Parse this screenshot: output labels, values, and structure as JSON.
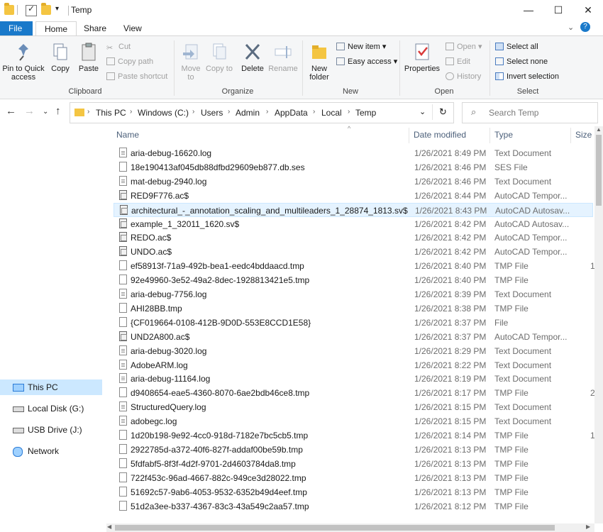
{
  "window": {
    "title": "Temp",
    "minimize": "—",
    "maximize": "☐",
    "close": "✕"
  },
  "tabs": [
    {
      "label": "File"
    },
    {
      "label": "Home"
    },
    {
      "label": "Share"
    },
    {
      "label": "View"
    }
  ],
  "ribbon": {
    "clipboard": {
      "label": "Clipboard",
      "pin": "Pin to Quick access",
      "copy": "Copy",
      "paste": "Paste",
      "cut": "Cut",
      "copy_path": "Copy path",
      "paste_shortcut": "Paste shortcut"
    },
    "organize": {
      "label": "Organize",
      "move_to": "Move to",
      "copy_to": "Copy to",
      "delete": "Delete",
      "rename": "Rename"
    },
    "new": {
      "label": "New",
      "new_folder": "New folder",
      "new_item": "New item",
      "easy_access": "Easy access"
    },
    "open": {
      "label": "Open",
      "properties": "Properties",
      "open": "Open",
      "edit": "Edit",
      "history": "History"
    },
    "select": {
      "label": "Select",
      "select_all": "Select all",
      "select_none": "Select none",
      "invert": "Invert selection"
    }
  },
  "address": {
    "crumbs": [
      "This PC",
      "Windows (C:)",
      "Users",
      "Admin",
      "AppData",
      "Local",
      "Temp"
    ],
    "search_placeholder": "Search Temp"
  },
  "nav": [
    {
      "label": "This PC",
      "icon": "monitor-icon",
      "selected": true
    },
    {
      "label": "Local Disk (G:)",
      "icon": "drive-icon"
    },
    {
      "label": "USB Drive (J:)",
      "icon": "usb-drive-icon"
    },
    {
      "label": "Network",
      "icon": "network-icon"
    }
  ],
  "columns": {
    "name": "Name",
    "date": "Date modified",
    "type": "Type",
    "size": "Size"
  },
  "files": [
    {
      "name": "aria-debug-16620.log",
      "date": "1/26/2021 8:49 PM",
      "type": "Text Document",
      "size": "",
      "icon": "doc"
    },
    {
      "name": "18e190413af045db88dfbd29609eb877.db.ses",
      "date": "1/26/2021 8:46 PM",
      "type": "SES File",
      "size": "",
      "icon": "file"
    },
    {
      "name": "mat-debug-2940.log",
      "date": "1/26/2021 8:46 PM",
      "type": "Text Document",
      "size": "",
      "icon": "doc"
    },
    {
      "name": "RED9F776.ac$",
      "date": "1/26/2021 8:44 PM",
      "type": "AutoCAD Tempor...",
      "size": "",
      "icon": "cad"
    },
    {
      "name": "architectural_-_annotation_scaling_and_multileaders_1_28874_1813.sv$",
      "date": "1/26/2021 8:43 PM",
      "type": "AutoCAD Autosav...",
      "size": "",
      "icon": "cad",
      "hover": true
    },
    {
      "name": "example_1_32011_1620.sv$",
      "date": "1/26/2021 8:42 PM",
      "type": "AutoCAD Autosav...",
      "size": "",
      "icon": "cad"
    },
    {
      "name": "REDO.ac$",
      "date": "1/26/2021 8:42 PM",
      "type": "AutoCAD Tempor...",
      "size": "",
      "icon": "cad"
    },
    {
      "name": "UNDO.ac$",
      "date": "1/26/2021 8:42 PM",
      "type": "AutoCAD Tempor...",
      "size": "",
      "icon": "cad"
    },
    {
      "name": "ef58913f-71a9-492b-bea1-eedc4bddaacd.tmp",
      "date": "1/26/2021 8:40 PM",
      "type": "TMP File",
      "size": "1",
      "icon": "file"
    },
    {
      "name": "92e49960-3e52-49a2-8dec-1928813421e5.tmp",
      "date": "1/26/2021 8:40 PM",
      "type": "TMP File",
      "size": "",
      "icon": "file"
    },
    {
      "name": "aria-debug-7756.log",
      "date": "1/26/2021 8:39 PM",
      "type": "Text Document",
      "size": "",
      "icon": "doc"
    },
    {
      "name": "AHI28BB.tmp",
      "date": "1/26/2021 8:38 PM",
      "type": "TMP File",
      "size": "",
      "icon": "file"
    },
    {
      "name": "{CF019664-0108-412B-9D0D-553E8CCD1E58}",
      "date": "1/26/2021 8:37 PM",
      "type": "File",
      "size": "",
      "icon": "file"
    },
    {
      "name": "UND2A800.ac$",
      "date": "1/26/2021 8:37 PM",
      "type": "AutoCAD Tempor...",
      "size": "",
      "icon": "cad"
    },
    {
      "name": "aria-debug-3020.log",
      "date": "1/26/2021 8:29 PM",
      "type": "Text Document",
      "size": "",
      "icon": "doc"
    },
    {
      "name": "AdobeARM.log",
      "date": "1/26/2021 8:22 PM",
      "type": "Text Document",
      "size": "",
      "icon": "doc"
    },
    {
      "name": "aria-debug-11164.log",
      "date": "1/26/2021 8:19 PM",
      "type": "Text Document",
      "size": "",
      "icon": "doc"
    },
    {
      "name": "d9408654-eae5-4360-8070-6ae2bdb46ce8.tmp",
      "date": "1/26/2021 8:17 PM",
      "type": "TMP File",
      "size": "2",
      "icon": "file"
    },
    {
      "name": "StructuredQuery.log",
      "date": "1/26/2021 8:15 PM",
      "type": "Text Document",
      "size": "",
      "icon": "doc"
    },
    {
      "name": "adobegc.log",
      "date": "1/26/2021 8:15 PM",
      "type": "Text Document",
      "size": "",
      "icon": "doc"
    },
    {
      "name": "1d20b198-9e92-4cc0-918d-7182e7bc5cb5.tmp",
      "date": "1/26/2021 8:14 PM",
      "type": "TMP File",
      "size": "1",
      "icon": "file"
    },
    {
      "name": "2922785d-a372-40f6-827f-addaf00be59b.tmp",
      "date": "1/26/2021 8:13 PM",
      "type": "TMP File",
      "size": "",
      "icon": "file"
    },
    {
      "name": "5fdfabf5-8f3f-4d2f-9701-2d4603784da8.tmp",
      "date": "1/26/2021 8:13 PM",
      "type": "TMP File",
      "size": "",
      "icon": "file"
    },
    {
      "name": "722f453c-96ad-4667-882c-949ce3d28022.tmp",
      "date": "1/26/2021 8:13 PM",
      "type": "TMP File",
      "size": "",
      "icon": "file"
    },
    {
      "name": "51692c57-9ab6-4053-9532-6352b49d4eef.tmp",
      "date": "1/26/2021 8:13 PM",
      "type": "TMP File",
      "size": "",
      "icon": "file"
    },
    {
      "name": "51d2a3ee-b337-4367-83c3-43a549c2aa57.tmp",
      "date": "1/26/2021 8:12 PM",
      "type": "TMP File",
      "size": "",
      "icon": "file"
    }
  ]
}
